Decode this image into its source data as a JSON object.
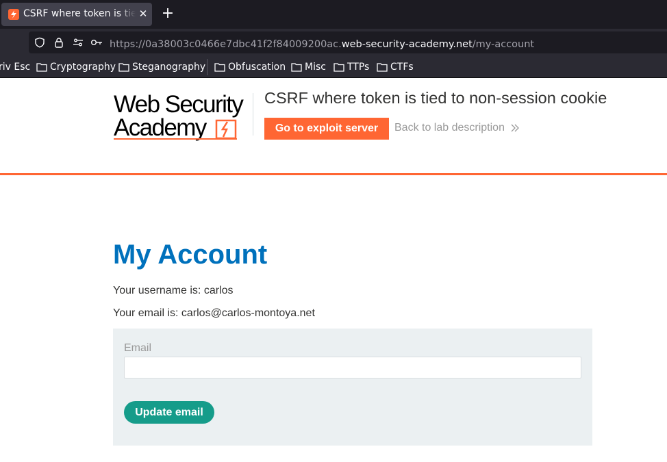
{
  "browser": {
    "tab_title": "CSRF where token is tied to non-session cookie",
    "url_prefix": "https://0a38003c0466e7dbc41f2f84009200ac.",
    "url_host": "web-security-academy.net",
    "url_path": "/my-account",
    "bookmarks": [
      {
        "label": "riv Esc"
      },
      {
        "label": "Cryptography"
      },
      {
        "label": "Steganography"
      },
      {
        "label": "Obfuscation"
      },
      {
        "label": "Misc"
      },
      {
        "label": "TTPs"
      },
      {
        "label": "CTFs"
      }
    ]
  },
  "header": {
    "logo_line1": "Web Security",
    "logo_line2": "Academy",
    "lab_title": "CSRF where token is tied to non-session cookie",
    "exploit_button": "Go to exploit server",
    "back_link": "Back to lab description"
  },
  "main": {
    "heading": "My Account",
    "username_text": "Your username is: carlos",
    "email_text": "Your email is: carlos@carlos-montoya.net",
    "form": {
      "email_label": "Email",
      "email_value": "",
      "submit_label": "Update email"
    }
  },
  "colors": {
    "accent": "#ff6633",
    "heading": "#0071bc",
    "submit": "#159c8a",
    "form_bg": "#ebf0f2"
  }
}
